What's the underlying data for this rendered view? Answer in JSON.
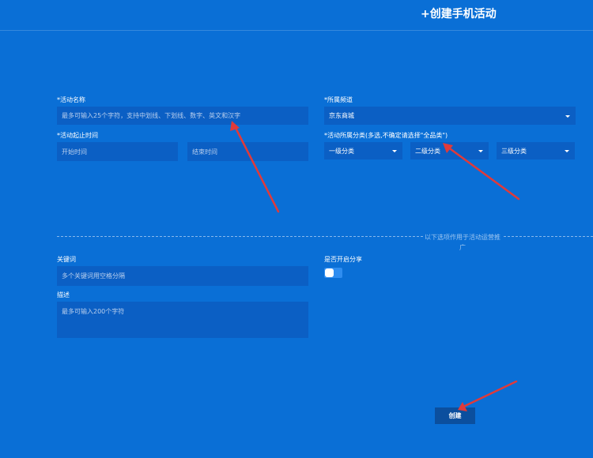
{
  "header": {
    "title": "+创建手机活动"
  },
  "form": {
    "name": {
      "label": "*活动名称",
      "placeholder": "最多可输入25个字符，支持中划线、下划线、数字、英文和汉字"
    },
    "time": {
      "label": "*活动起止时间",
      "start_placeholder": "开始时间",
      "end_placeholder": "结束时间"
    },
    "channel": {
      "label": "*所属频道",
      "value": "京东商城"
    },
    "category": {
      "label": "*活动所属分类(多选,不确定请选择\"全品类\")",
      "level1": "一级分类",
      "level2": "二级分类",
      "level3": "三级分类"
    },
    "divider_note": "以下选项作用于活动运营推广",
    "keywords": {
      "label": "关键词",
      "placeholder": "多个关键词用空格分隔"
    },
    "description": {
      "label": "描述",
      "placeholder": "最多可输入200个字符"
    },
    "share": {
      "label": "是否开启分享",
      "enabled": false
    },
    "create_label": "创建"
  },
  "colors": {
    "background": "#0a6fd6",
    "field": "#0b5fc4",
    "button": "#0b4f9e",
    "annotation_arrow": "#e03a3a"
  }
}
